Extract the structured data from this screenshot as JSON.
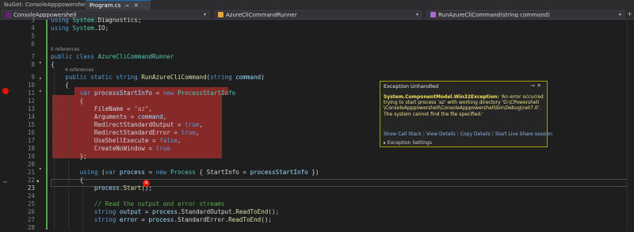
{
  "tabs": {
    "inactive_label": "NuGet: ConsoleApppowershell",
    "active_label": "Program.cs",
    "pin_icon": "pin-icon",
    "close_icon": "close-icon"
  },
  "navbar": {
    "project": "ConsoleApppowershell",
    "class": "AzureCliCommandRunner",
    "member": "RunAzureCliCommand(string command)"
  },
  "code": {
    "lines": [
      {
        "n": "3",
        "t": "using System.Diagnostics;"
      },
      {
        "n": "4",
        "t": "using System.IO;"
      },
      {
        "n": "5",
        "t": ""
      },
      {
        "n": "6",
        "t": ""
      },
      {
        "n": "7",
        "t": "public class AzureCliCommandRunner"
      },
      {
        "n": "8",
        "t": "{"
      },
      {
        "n": "9",
        "t": "    public static string RunAzureCliCommand(string command)"
      },
      {
        "n": "10",
        "t": "    {"
      },
      {
        "n": "11",
        "t": "        var processStartInfo = new ProcessStartInfo"
      },
      {
        "n": "12",
        "t": "        {"
      },
      {
        "n": "13",
        "t": "            FileName = \"az\","
      },
      {
        "n": "14",
        "t": "            Arguments = command,"
      },
      {
        "n": "15",
        "t": "            RedirectStandardOutput = true,"
      },
      {
        "n": "16",
        "t": "            RedirectStandardError = true,"
      },
      {
        "n": "17",
        "t": "            UseShellExecute = false,"
      },
      {
        "n": "18",
        "t": "            CreateNoWindow = true"
      },
      {
        "n": "19",
        "t": "        };"
      },
      {
        "n": "20",
        "t": ""
      },
      {
        "n": "21",
        "t": "        using (var process = new Process { StartInfo = processStartInfo })"
      },
      {
        "n": "22",
        "t": "        {"
      },
      {
        "n": "23",
        "t": "            process.Start();"
      },
      {
        "n": "24",
        "t": ""
      },
      {
        "n": "25",
        "t": "            // Read the output and error streams"
      },
      {
        "n": "26",
        "t": "            string output = process.StandardOutput.ReadToEnd();"
      },
      {
        "n": "27",
        "t": "            string error = process.StandardError.ReadToEnd();"
      },
      {
        "n": "28",
        "t": ""
      }
    ],
    "refs_class": "0 references",
    "refs_method": "4 references"
  },
  "exception": {
    "title": "Exception Unhandled",
    "type": "System.ComponentModel.Win32Exception:",
    "message": " 'An error occurred trying to start process 'az' with working directory 'D:\\CPowershell \\ConsoleApppowershell\\ConsoleApppowershell\\bin\\Debug\\net7.0'. The system cannot find the file specified.'",
    "links": [
      "Show Call Stack",
      "View Details",
      "Copy Details",
      "Start Live Share session"
    ],
    "settings": "Exception Settings"
  },
  "colors": {
    "error_red": "#e51400",
    "highlight_red": "#8b2a2a",
    "popup_border": "#a0a000"
  }
}
